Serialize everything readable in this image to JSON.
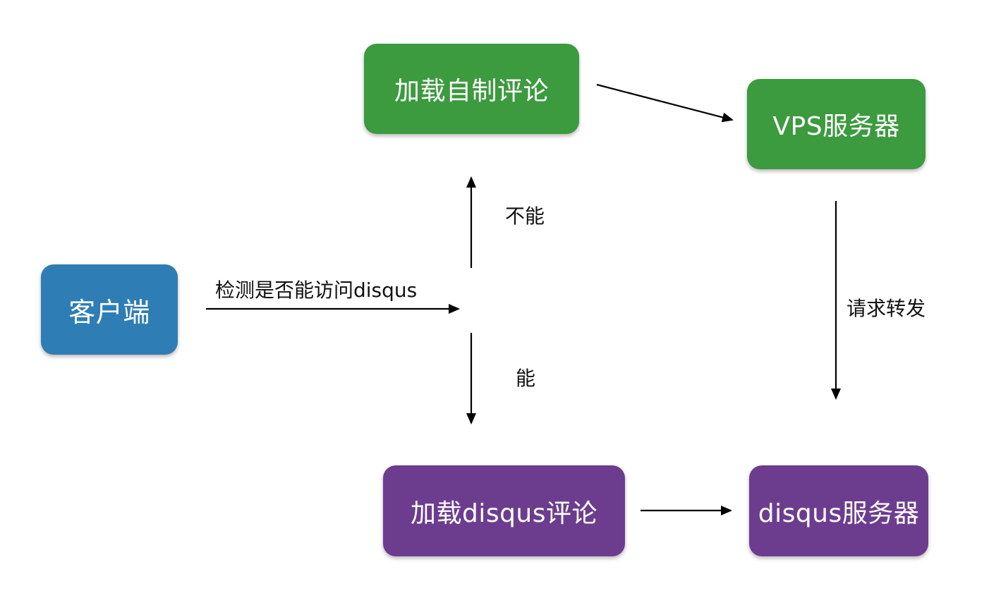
{
  "nodes": {
    "client": {
      "label": "客户端"
    },
    "load_custom": {
      "label": "加载自制评论"
    },
    "vps_server": {
      "label": "VPS服务器"
    },
    "load_disqus": {
      "label": "加载disqus评论"
    },
    "disqus_server": {
      "label": "disqus服务器"
    }
  },
  "edges": {
    "check": {
      "label": "检测是否能访问disqus"
    },
    "cannot": {
      "label": "不能"
    },
    "can": {
      "label": "能"
    },
    "forward": {
      "label": "请求转发"
    }
  },
  "colors": {
    "blue": "#2f7db5",
    "green": "#3c9a3f",
    "purple": "#6c3d8f",
    "arrow": "#000000"
  }
}
